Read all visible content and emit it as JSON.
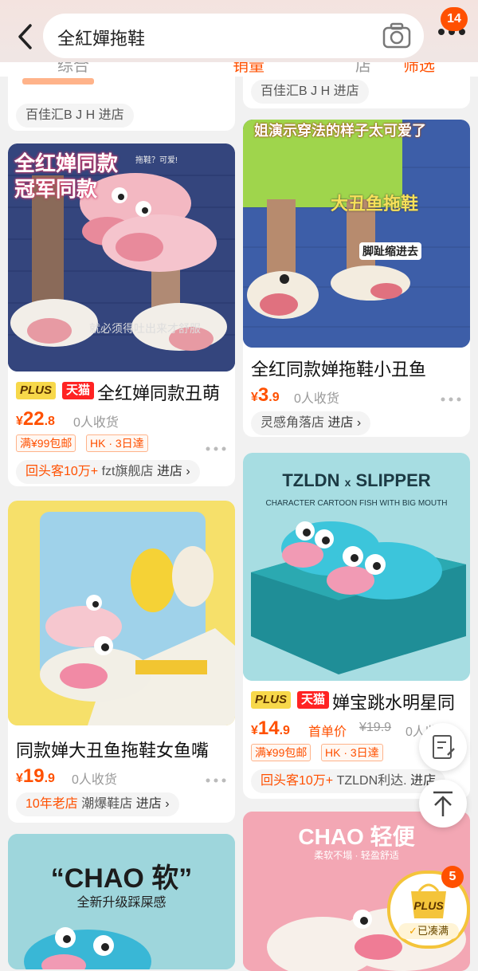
{
  "header": {
    "search_query": "全紅嬋拖鞋",
    "notification_count": "14",
    "back_icon": "chevron-left-icon",
    "camera_icon": "camera-icon",
    "more_icon": "more-dots-icon"
  },
  "sortbar": {
    "items": [
      "综合",
      "销量",
      "店",
      "筛选"
    ]
  },
  "top_partial": {
    "left_store": "百佳汇B J H 进店",
    "right_store": "百佳汇B J H 进店"
  },
  "left_col": [
    {
      "overlay_line1": "全红婵同款",
      "overlay_line2": "冠军同款",
      "caption_top": "拖鞋？可爱!",
      "caption_bottom": "就必须得吐出来才舒服",
      "tag_plus": "PLUS",
      "tag_tmall": "天猫",
      "title": "全红婵同款丑萌",
      "price_symbol": "¥",
      "price_int": "22",
      "price_dec": ".8",
      "sold": "0人收货",
      "tags": [
        "满¥99包邮",
        "HK · 3日達"
      ],
      "store_highlight": "回头客10万+",
      "store_name": "fzt旗舰店",
      "store_go": "进店"
    },
    {
      "title": "同款婵大丑鱼拖鞋女鱼嘴",
      "price_symbol": "¥",
      "price_int": "19",
      "price_dec": ".9",
      "sold": "0人收货",
      "store_highlight": "10年老店",
      "store_name": "潮爆鞋店",
      "store_go": "进店"
    },
    {
      "overlay_line1": "“CHAO 软”",
      "overlay_line2": "全新升级踩屎感"
    }
  ],
  "right_col": [
    {
      "overlay_top": "姐演示穿法的样子太可爱了",
      "overlay_line1": "大丑鱼拖鞋",
      "overlay_note": "脚趾缩进去",
      "title": "全红同款婵拖鞋小丑鱼",
      "price_symbol": "¥",
      "price_int": "3",
      "price_dec": ".9",
      "sold": "0人收货",
      "store_name": "灵感角落店",
      "store_go": "进店"
    },
    {
      "brand": "TZLDN",
      "brand_x": "x",
      "brand2": "SLIPPER",
      "subtitle": "CHARACTER CARTOON FISH WITH BIG MOUTH",
      "tag_plus": "PLUS",
      "tag_tmall": "天猫",
      "title": "婵宝跳水明星同",
      "price_symbol": "¥",
      "price_int": "14",
      "price_dec": ".9",
      "first_order": "首单价",
      "old_price": "¥19.9",
      "sold": "0人收货",
      "tags": [
        "满¥99包邮",
        "HK · 3日達"
      ],
      "store_highlight": "回头客10万+",
      "store_name": "TZLDN利达.",
      "store_go": "进店"
    },
    {
      "overlay_line1": "CHAO 轻便",
      "overlay_line2": "柔软不塌 · 轻盈舒适"
    }
  ],
  "floating": {
    "feedback_icon": "edit-note-icon",
    "top_icon": "back-to-top-icon",
    "basket_label": "PLUS",
    "basket_status": "已凑满",
    "basket_count": "5"
  },
  "colors": {
    "accent": "#ff5000",
    "plus_yellow": "#f7d84a",
    "tmall_red": "#ff2323"
  }
}
